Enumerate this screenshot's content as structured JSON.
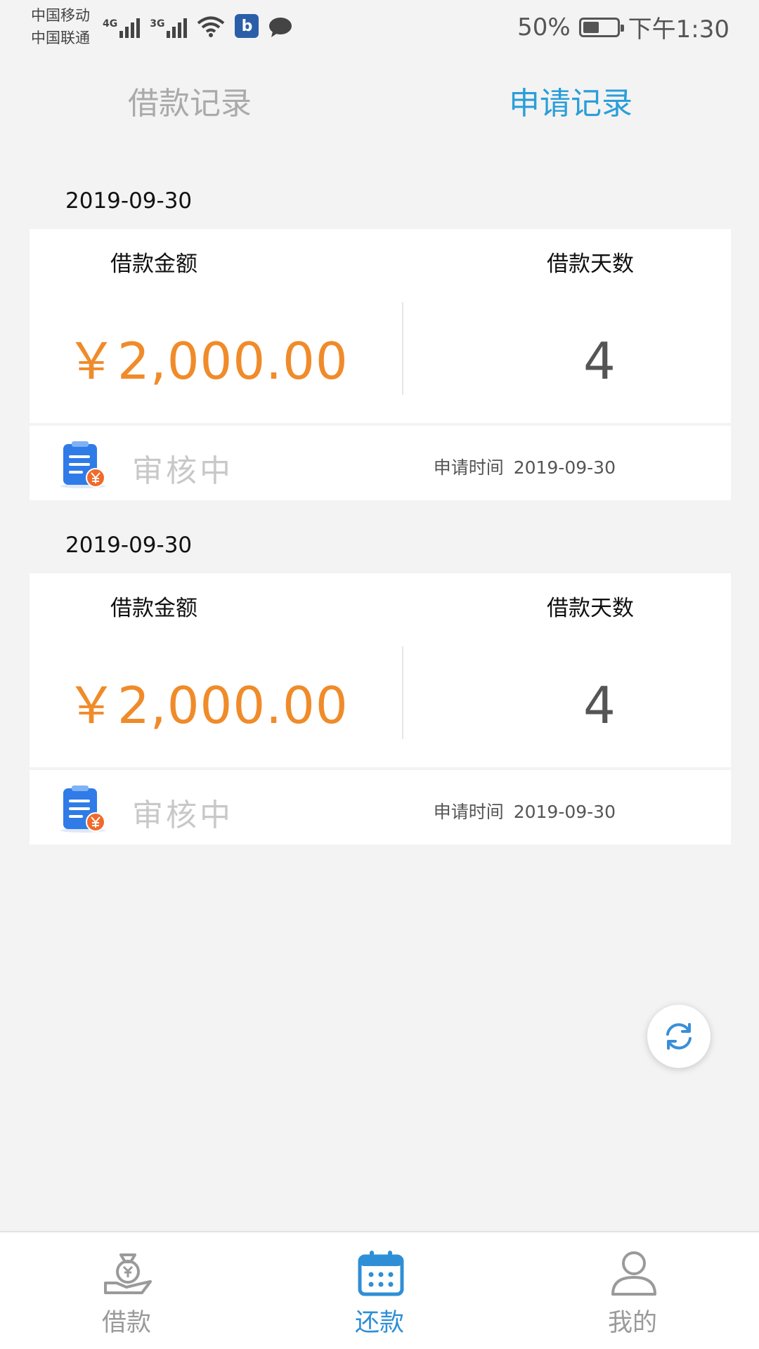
{
  "status_bar": {
    "carrier1": "中国移动",
    "carrier2": "中国联通",
    "net1": "4G",
    "net2": "3G",
    "app_icon_letter": "b",
    "battery_level": 0.5,
    "battery_text": "50%",
    "time": "下午1:30"
  },
  "tabs": {
    "loan_record": "借款记录",
    "apply_record": "申请记录",
    "active": "apply_record"
  },
  "records": [
    {
      "date": "2019-09-30",
      "amount_label": "借款金额",
      "days_label": "借款天数",
      "amount": "￥2,000.00",
      "days": "4",
      "status": "审核中",
      "apply_time_label": "申请时间",
      "apply_time": "2019-09-30"
    },
    {
      "date": "2019-09-30",
      "amount_label": "借款金额",
      "days_label": "借款天数",
      "amount": "￥2,000.00",
      "days": "4",
      "status": "审核中",
      "apply_time_label": "申请时间",
      "apply_time": "2019-09-30"
    }
  ],
  "refresh_button": {
    "icon": "refresh-icon"
  },
  "bottom_nav": {
    "items": [
      {
        "label": "借款",
        "icon": "money-bag-hand-icon"
      },
      {
        "label": "还款",
        "icon": "calendar-icon",
        "active": true
      },
      {
        "label": "我的",
        "icon": "person-icon"
      }
    ]
  },
  "colors": {
    "accent": "#2a9ed9",
    "amount": "#f08b2a",
    "background": "#f3f3f3"
  }
}
